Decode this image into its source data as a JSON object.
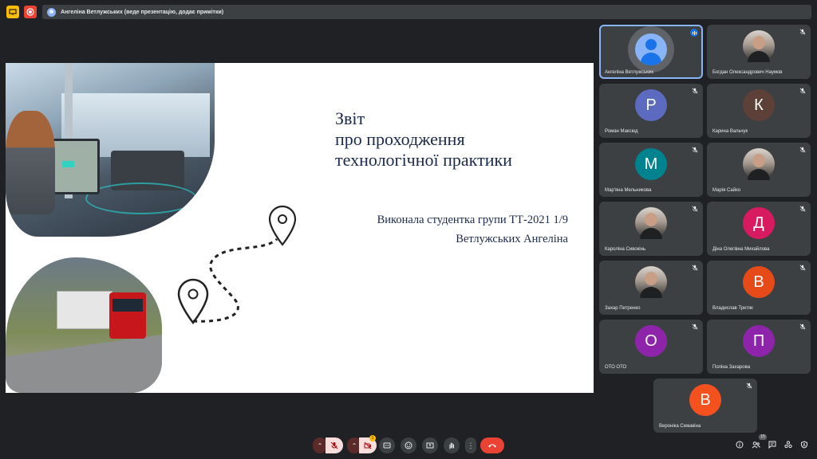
{
  "presenter_bar": {
    "text": "Ангеліна Ветлужських (веде презентацію, додає примітки)"
  },
  "slide": {
    "title_lines": [
      "Звіт",
      "про проходження",
      "технологічної практики"
    ],
    "subtitle_lines": [
      "Виконала студентка групи ТТ-2021 1/9",
      "Ветлужських Ангеліна"
    ]
  },
  "participants": [
    {
      "name": "Ангеліна Ветлужських",
      "avatar": "default",
      "initial": "",
      "color": "#5f6368",
      "speaking": true
    },
    {
      "name": "Богдан Олександрович Наумов",
      "avatar": "photo",
      "initial": "",
      "color": "#444"
    },
    {
      "name": "Роман Максюд",
      "avatar": "letter",
      "initial": "Р",
      "color": "#5c6bc0"
    },
    {
      "name": "Карина Вальчук",
      "avatar": "letter",
      "initial": "К",
      "color": "#5d4037"
    },
    {
      "name": "Мар'яна Мельникова",
      "avatar": "letter",
      "initial": "М",
      "color": "#00838f"
    },
    {
      "name": "Марія Сайко",
      "avatar": "photo",
      "initial": "",
      "color": "#444"
    },
    {
      "name": "Кароліна Сивокінь",
      "avatar": "photo",
      "initial": "",
      "color": "#444"
    },
    {
      "name": "Діна Олегівна Михайлова",
      "avatar": "letter",
      "initial": "Д",
      "color": "#d81b60"
    },
    {
      "name": "Захар Петренко",
      "avatar": "photo",
      "initial": "",
      "color": "#444"
    },
    {
      "name": "Владислав Третяк",
      "avatar": "letter",
      "initial": "В",
      "color": "#e64a19"
    },
    {
      "name": "ОТО ОТО",
      "avatar": "letter",
      "initial": "О",
      "color": "#8e24aa"
    },
    {
      "name": "Поліна Захарова",
      "avatar": "letter",
      "initial": "П",
      "color": "#8e24aa"
    },
    {
      "name": "Вероніка Семакіна",
      "avatar": "letter",
      "initial": "В",
      "color": "#f4511e"
    }
  ],
  "controls": {
    "participant_count": "15",
    "notification_badge": "1",
    "icons": [
      "chevron-up-icon",
      "mic-off-icon",
      "chevron-up-icon",
      "camera-off-icon",
      "captions-icon",
      "emoji-icon",
      "present-icon",
      "raise-hand-icon",
      "more-options-icon",
      "end-call-icon",
      "info-icon",
      "people-icon",
      "chat-icon",
      "activities-icon",
      "host-controls-icon"
    ]
  },
  "colors": {
    "background": "#202124",
    "tile": "#3c4043",
    "accent": "#8ab4f8",
    "end_call": "#ea4335"
  }
}
